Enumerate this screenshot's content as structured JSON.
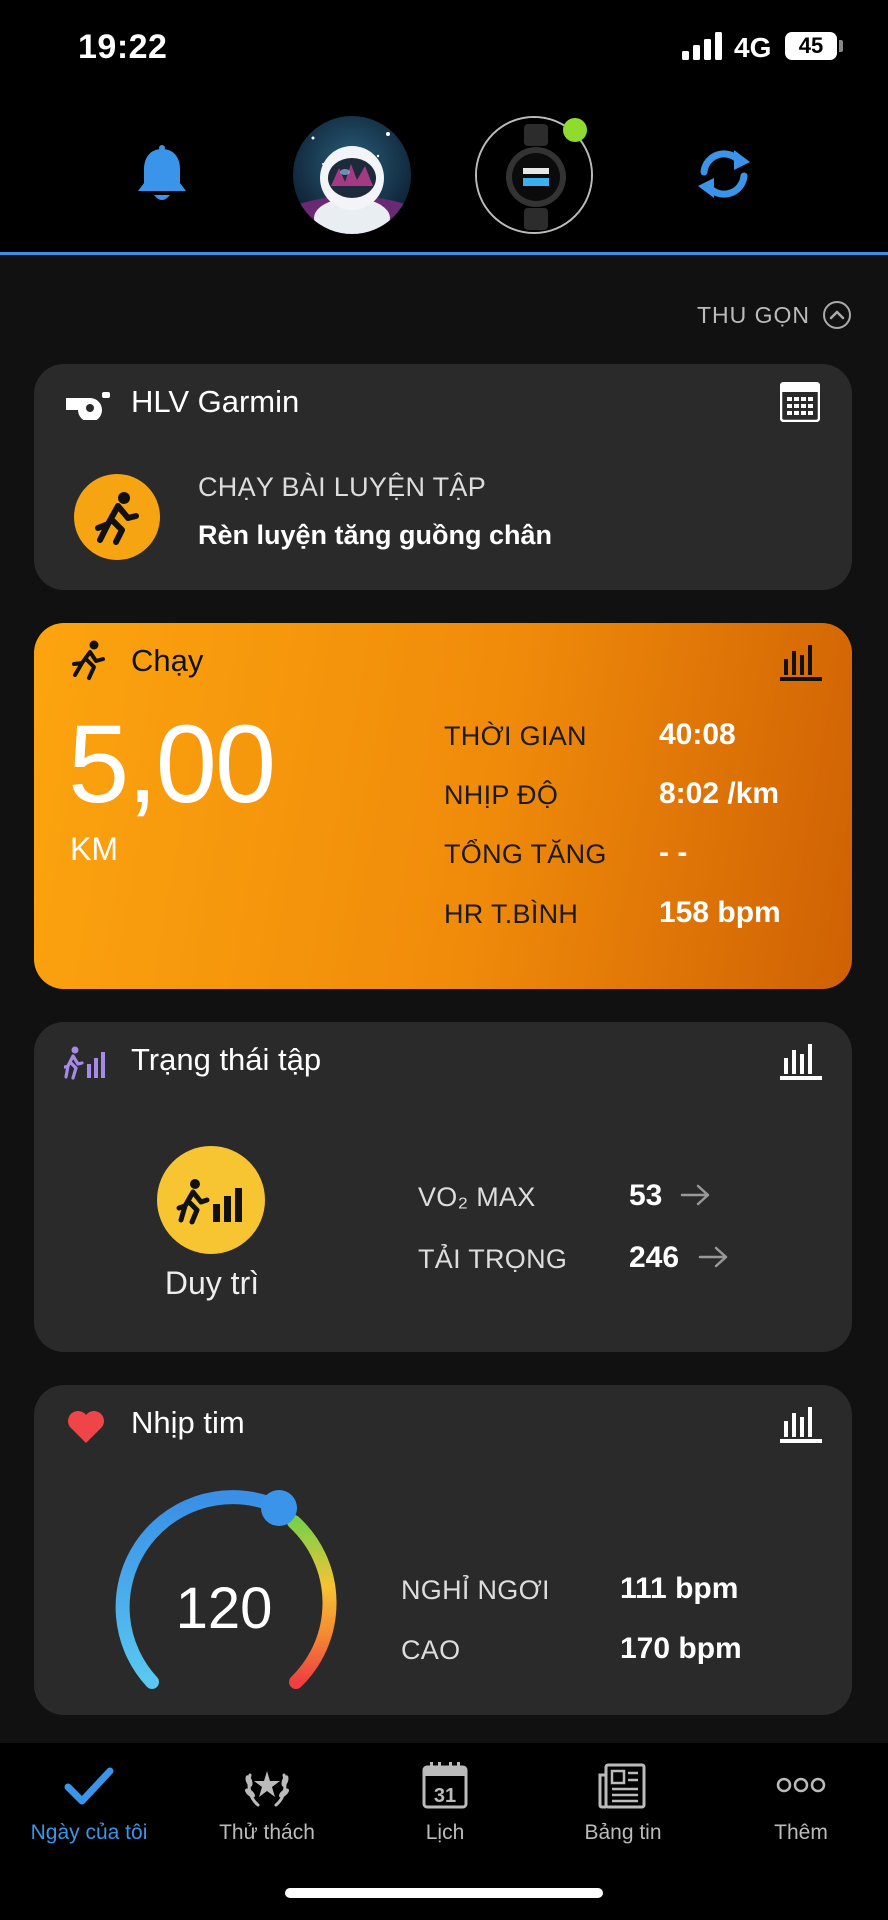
{
  "status_bar": {
    "time": "19:22",
    "network": "4G",
    "battery": "45"
  },
  "collapse": {
    "label": "THU GỌN"
  },
  "coach": {
    "title": "HLV Garmin",
    "workout_type": "CHẠY BÀI LUYỆN TẬP",
    "workout_name": "Rèn luyện tăng guồng chân"
  },
  "run": {
    "title": "Chạy",
    "distance": "5,00",
    "unit": "KM",
    "stats": [
      {
        "label": "THỜI GIAN",
        "value": "40:08"
      },
      {
        "label": "NHỊP ĐỘ",
        "value": "8:02 /km"
      },
      {
        "label": "TỔNG TĂNG",
        "value": "- -"
      },
      {
        "label": "HR T.BÌNH",
        "value": "158 bpm"
      }
    ]
  },
  "training": {
    "title": "Trạng thái tập",
    "status": "Duy trì",
    "vo2_label": "VO₂ MAX",
    "vo2_value": "53",
    "load_label": "TẢI TRỌNG",
    "load_value": "246"
  },
  "heart_rate": {
    "title": "Nhịp tim",
    "current": "120",
    "resting_label": "NGHỈ NGƠI",
    "resting_value": "111 bpm",
    "high_label": "CAO",
    "high_value": "170 bpm"
  },
  "nav": {
    "items": [
      {
        "label": "Ngày của tôi",
        "icon": "check-icon",
        "active": true
      },
      {
        "label": "Thử thách",
        "icon": "laurel-icon"
      },
      {
        "label": "Lịch",
        "icon": "calendar-icon",
        "day": "31"
      },
      {
        "label": "Bảng tin",
        "icon": "newspaper-icon"
      },
      {
        "label": "Thêm",
        "icon": "more-icon"
      }
    ]
  },
  "colors": {
    "accent": "#3a95ea",
    "run_orange": "#f79a0c",
    "status_yellow": "#f7c531",
    "heart_red": "#ef4548",
    "device_connected": "#8fdc2f"
  }
}
